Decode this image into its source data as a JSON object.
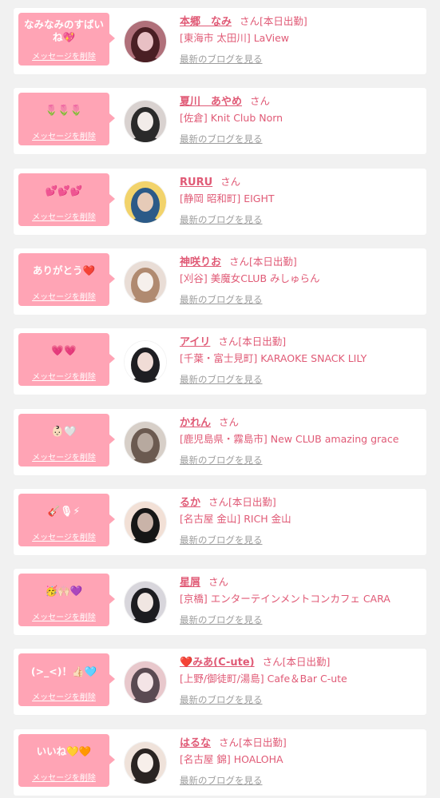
{
  "delete_label": "メッセージを削除",
  "blog_label": "最新のブログを見る",
  "honorific": "さん",
  "colors": {
    "bubble": "#ffa4b5",
    "accent": "#e05a76",
    "muted": "#9d9d9d"
  },
  "cards": [
    {
      "message": "なみなみのすばいね💖",
      "name": "本郷　なみ",
      "status": "[本日出勤]",
      "shop": "[東海市 太田川] LaView",
      "avatar_icon": "cast-photo-1",
      "avatar_colors": [
        "#4a1f24",
        "#b0707a",
        "#e8c0c4"
      ]
    },
    {
      "message": "🌷🌷🌷",
      "name": "夏川　あやめ",
      "status": "",
      "shop": "[佐倉] Knit Club Norn",
      "avatar_icon": "cast-photo-2",
      "avatar_colors": [
        "#2a2a2a",
        "#d9d2d0",
        "#f2ece9"
      ]
    },
    {
      "message": "💕💕💕",
      "name": "RURU",
      "status": "",
      "shop": "[静岡 昭和町] EIGHT",
      "avatar_icon": "cast-photo-3",
      "avatar_colors": [
        "#2b5a88",
        "#f2d36b",
        "#e6cbb8"
      ]
    },
    {
      "message": "ありがとう❤️",
      "name": "神咲りお",
      "status": "[本日出勤]",
      "shop": "[刈谷] 美魔女CLUB みしゅらん",
      "avatar_icon": "cast-photo-4",
      "avatar_colors": [
        "#b08a70",
        "#e9ddd6",
        "#f6f0ec"
      ]
    },
    {
      "message": "💗💗",
      "name": "アイリ",
      "status": "[本日出勤]",
      "shop": "[千葉・富士見町] KARAOKE SNACK LILY",
      "avatar_icon": "cast-photo-5",
      "avatar_colors": [
        "#1e1e22",
        "#ffffff",
        "#f0dcd6"
      ]
    },
    {
      "message": "👶🏻🤍",
      "name": "かれん",
      "status": "",
      "shop": "[鹿児島県・霧島市] New CLUB amazing grace",
      "avatar_icon": "cast-photo-6",
      "avatar_colors": [
        "#6b5a50",
        "#d7cfc8",
        "#b7a99f"
      ]
    },
    {
      "message": "🎸🎙⚡",
      "name": "るか",
      "status": "[本日出勤]",
      "shop": "[名古屋 金山] RICH 金山",
      "avatar_icon": "cast-photo-7",
      "avatar_colors": [
        "#161616",
        "#f2e0d6",
        "#c9b3a8"
      ]
    },
    {
      "message": "🥳🙌🏻💜",
      "name": "星屑",
      "status": "",
      "shop": "[京橋] エンターテインメントコンカフェ CARA",
      "avatar_icon": "cast-photo-8",
      "avatar_colors": [
        "#1c1c20",
        "#d8d6dc",
        "#f0e6e2"
      ]
    },
    {
      "message": "(>_<)！👍🏻🩵",
      "name": "❤️みあ(C-ute)",
      "status": "[本日出勤]",
      "shop": "[上野/御徒町/湯島] Cafe＆Bar C-ute",
      "avatar_icon": "cast-photo-9",
      "avatar_colors": [
        "#5a4a52",
        "#e8c8cc",
        "#f4e4e6"
      ]
    },
    {
      "message": "いいね💛🧡",
      "name": "はるな",
      "status": "[本日出勤]",
      "shop": "[名古屋 錦] HOALOHA",
      "avatar_icon": "cast-photo-10",
      "avatar_colors": [
        "#2a2422",
        "#efe2da",
        "#f7efea"
      ]
    }
  ]
}
